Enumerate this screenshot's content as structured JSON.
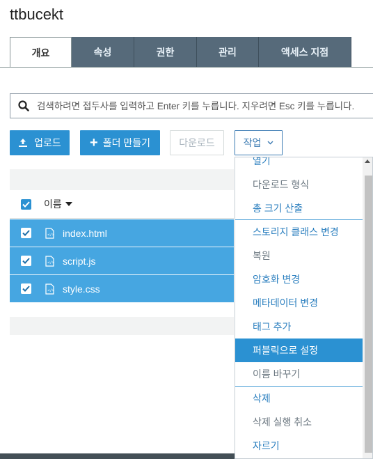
{
  "bucket": {
    "name": "ttbucekt"
  },
  "tabs": [
    {
      "label": "개요"
    },
    {
      "label": "속성"
    },
    {
      "label": "권한"
    },
    {
      "label": "관리"
    },
    {
      "label": "액세스 지점"
    }
  ],
  "search": {
    "placeholder": "검색하려면 접두사를 입력하고 Enter 키를 누릅니다. 지우려면 Esc 키를 누릅니다."
  },
  "toolbar": {
    "upload_label": "업로드",
    "create_folder_label": "폴더 만들기",
    "download_label": "다운로드",
    "actions_label": "작업"
  },
  "table": {
    "name_header": "이름",
    "rows": [
      {
        "name": "index.html",
        "checked": true
      },
      {
        "name": "script.js",
        "checked": true
      },
      {
        "name": "style.css",
        "checked": true
      }
    ]
  },
  "actions_menu": {
    "items": [
      {
        "label": "열기"
      },
      {
        "label": "다운로드 형식"
      },
      {
        "label": "총 크기 산출"
      },
      {
        "label": "스토리지 클래스 변경"
      },
      {
        "label": "복원"
      },
      {
        "label": "암호화 변경"
      },
      {
        "label": "메타데이터 변경"
      },
      {
        "label": "태그 추가"
      },
      {
        "label": "퍼블릭으로 설정"
      },
      {
        "label": "이름 바꾸기"
      },
      {
        "label": "삭제"
      },
      {
        "label": "삭제 실행 취소"
      },
      {
        "label": "자르기"
      }
    ]
  },
  "colors": {
    "accent": "#2b91d2",
    "selected_row": "#46a6e1",
    "tab_bg": "#566a7a",
    "link": "#2b7fbf"
  }
}
